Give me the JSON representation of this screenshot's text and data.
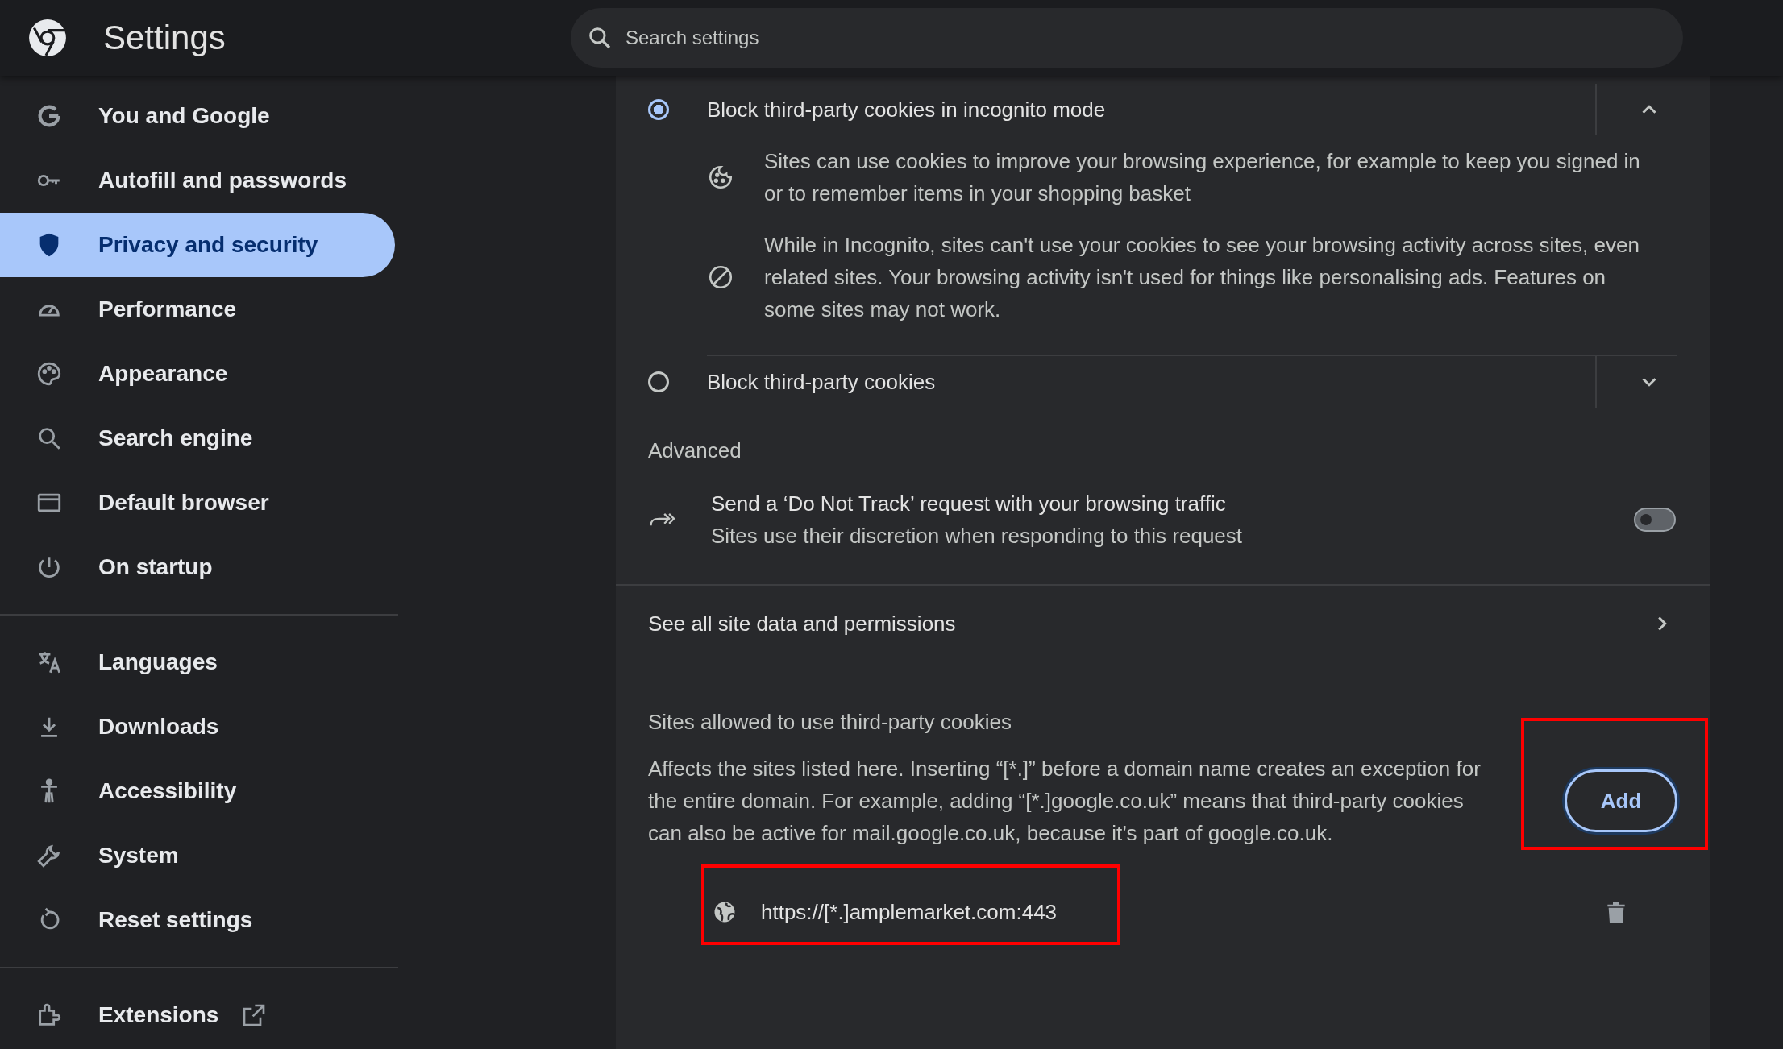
{
  "header": {
    "title": "Settings",
    "search": {
      "placeholder": "Search settings"
    }
  },
  "sidebar": {
    "groups": [
      {
        "items": [
          {
            "label": "You and Google",
            "selected": false
          },
          {
            "label": "Autofill and passwords",
            "selected": false
          },
          {
            "label": "Privacy and security",
            "selected": true
          },
          {
            "label": "Performance",
            "selected": false
          },
          {
            "label": "Appearance",
            "selected": false
          },
          {
            "label": "Search engine",
            "selected": false
          },
          {
            "label": "Default browser",
            "selected": false
          },
          {
            "label": "On startup",
            "selected": false
          }
        ]
      },
      {
        "items": [
          {
            "label": "Languages",
            "selected": false
          },
          {
            "label": "Downloads",
            "selected": false
          },
          {
            "label": "Accessibility",
            "selected": false
          },
          {
            "label": "System",
            "selected": false
          },
          {
            "label": "Reset settings",
            "selected": false
          }
        ]
      },
      {
        "items": [
          {
            "label": "Extensions",
            "selected": false,
            "external": true
          }
        ]
      }
    ]
  },
  "cookie_options": [
    {
      "label": "Block third-party cookies in incognito mode",
      "selected": true,
      "expanded": true,
      "details": [
        "Sites can use cookies to improve your browsing experience, for example to keep you signed in or to remember items in your shopping basket",
        "While in Incognito, sites can't use your cookies to see your browsing activity across sites, even related sites. Your browsing activity isn't used for things like personalising ads. Features on some sites may not work."
      ]
    },
    {
      "label": "Block third-party cookies",
      "selected": false,
      "expanded": false
    }
  ],
  "advanced": {
    "heading": "Advanced",
    "do_not_track": {
      "title": "Send a ‘Do Not Track’ request with your browsing traffic",
      "subtitle": "Sites use their discretion when responding to this request",
      "on": false
    }
  },
  "site_data_link": "See all site data and permissions",
  "allowed_sites": {
    "heading": "Sites allowed to use third-party cookies",
    "description": "Affects the sites listed here. Inserting “[*.]” before a domain name creates an exception for the entire domain. For example, adding “[*.]google.co.uk” means that third-party cookies can also be active for mail.google.co.uk, because it’s part of google.co.uk.",
    "add_button": {
      "label": "Add",
      "highlighted": true
    },
    "sites": [
      {
        "url": "https://[*.]amplemarket.com:443",
        "highlighted": true
      }
    ]
  }
}
